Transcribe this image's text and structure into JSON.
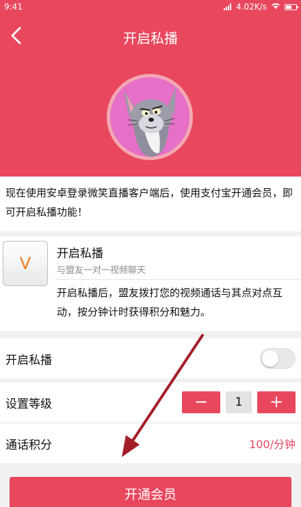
{
  "status_bar": {
    "time": "9:41",
    "network_speed": "4.02K/s",
    "wifi_icon": "wifi-icon",
    "signal_icon": "signal-icon",
    "battery_icon": "battery-icon"
  },
  "header": {
    "title": "开启私播",
    "back_icon": "chevron-left-icon"
  },
  "intro": {
    "text": "现在使用安卓登录微笑直播客户端后，使用支付宝开通会员，即可开启私播功能！"
  },
  "feature": {
    "badge_letter": "V",
    "title": "开启私播",
    "subtitle": "与盟友一对一视频聊天",
    "description": "开启私播后，盟友拨打您的视频通话与其点对点互动，按分钟计时获得积分和魅力。"
  },
  "settings": {
    "private_broadcast": {
      "label": "开启私播",
      "enabled": false
    },
    "level": {
      "label": "设置等级",
      "value": "1",
      "minus": "−",
      "plus": "+"
    },
    "call_points": {
      "label": "通话积分",
      "value": "100/分钟"
    }
  },
  "cta": {
    "label": "开通会员"
  },
  "colors": {
    "primary": "#e8475e",
    "badge_text": "#f07b1d"
  }
}
